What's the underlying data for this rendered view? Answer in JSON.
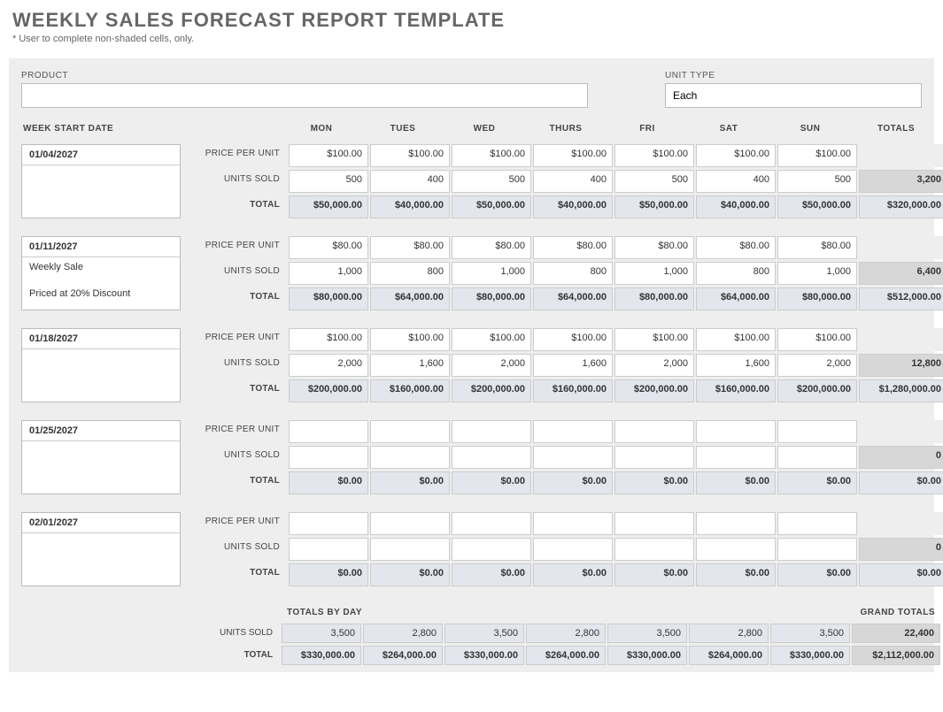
{
  "title": "WEEKLY SALES FORECAST REPORT TEMPLATE",
  "note": "* User to complete non-shaded cells, only.",
  "fields": {
    "product_label": "PRODUCT",
    "product_value": "",
    "unit_type_label": "UNIT TYPE",
    "unit_type_value": "Each"
  },
  "headers": {
    "week_start": "WEEK START DATE",
    "days": [
      "MON",
      "TUES",
      "WED",
      "THURS",
      "FRI",
      "SAT",
      "SUN"
    ],
    "totals": "TOTALS"
  },
  "row_labels": {
    "price": "PRICE PER UNIT",
    "units": "UNITS SOLD",
    "total": "TOTAL"
  },
  "weeks": [
    {
      "date": "01/04/2027",
      "note1": "",
      "note2": "",
      "price": [
        "$100.00",
        "$100.00",
        "$100.00",
        "$100.00",
        "$100.00",
        "$100.00",
        "$100.00"
      ],
      "units": [
        "500",
        "400",
        "500",
        "400",
        "500",
        "400",
        "500"
      ],
      "units_total": "3,200",
      "total": [
        "$50,000.00",
        "$40,000.00",
        "$50,000.00",
        "$40,000.00",
        "$50,000.00",
        "$40,000.00",
        "$50,000.00"
      ],
      "total_sum": "$320,000.00"
    },
    {
      "date": "01/11/2027",
      "note1": "Weekly Sale",
      "note2": "Priced at 20% Discount",
      "price": [
        "$80.00",
        "$80.00",
        "$80.00",
        "$80.00",
        "$80.00",
        "$80.00",
        "$80.00"
      ],
      "units": [
        "1,000",
        "800",
        "1,000",
        "800",
        "1,000",
        "800",
        "1,000"
      ],
      "units_total": "6,400",
      "total": [
        "$80,000.00",
        "$64,000.00",
        "$80,000.00",
        "$64,000.00",
        "$80,000.00",
        "$64,000.00",
        "$80,000.00"
      ],
      "total_sum": "$512,000.00"
    },
    {
      "date": "01/18/2027",
      "note1": "",
      "note2": "",
      "price": [
        "$100.00",
        "$100.00",
        "$100.00",
        "$100.00",
        "$100.00",
        "$100.00",
        "$100.00"
      ],
      "units": [
        "2,000",
        "1,600",
        "2,000",
        "1,600",
        "2,000",
        "1,600",
        "2,000"
      ],
      "units_total": "12,800",
      "total": [
        "$200,000.00",
        "$160,000.00",
        "$200,000.00",
        "$160,000.00",
        "$200,000.00",
        "$160,000.00",
        "$200,000.00"
      ],
      "total_sum": "$1,280,000.00"
    },
    {
      "date": "01/25/2027",
      "note1": "",
      "note2": "",
      "price": [
        "",
        "",
        "",
        "",
        "",
        "",
        ""
      ],
      "units": [
        "",
        "",
        "",
        "",
        "",
        "",
        ""
      ],
      "units_total": "0",
      "total": [
        "$0.00",
        "$0.00",
        "$0.00",
        "$0.00",
        "$0.00",
        "$0.00",
        "$0.00"
      ],
      "total_sum": "$0.00"
    },
    {
      "date": "02/01/2027",
      "note1": "",
      "note2": "",
      "price": [
        "",
        "",
        "",
        "",
        "",
        "",
        ""
      ],
      "units": [
        "",
        "",
        "",
        "",
        "",
        "",
        ""
      ],
      "units_total": "0",
      "total": [
        "$0.00",
        "$0.00",
        "$0.00",
        "$0.00",
        "$0.00",
        "$0.00",
        "$0.00"
      ],
      "total_sum": "$0.00"
    }
  ],
  "summary": {
    "by_day_label": "TOTALS BY DAY",
    "grand_label": "GRAND TOTALS",
    "units": [
      "3,500",
      "2,800",
      "3,500",
      "2,800",
      "3,500",
      "2,800",
      "3,500"
    ],
    "units_total": "22,400",
    "total": [
      "$330,000.00",
      "$264,000.00",
      "$330,000.00",
      "$264,000.00",
      "$330,000.00",
      "$264,000.00",
      "$330,000.00"
    ],
    "grand_total": "$2,112,000.00"
  }
}
